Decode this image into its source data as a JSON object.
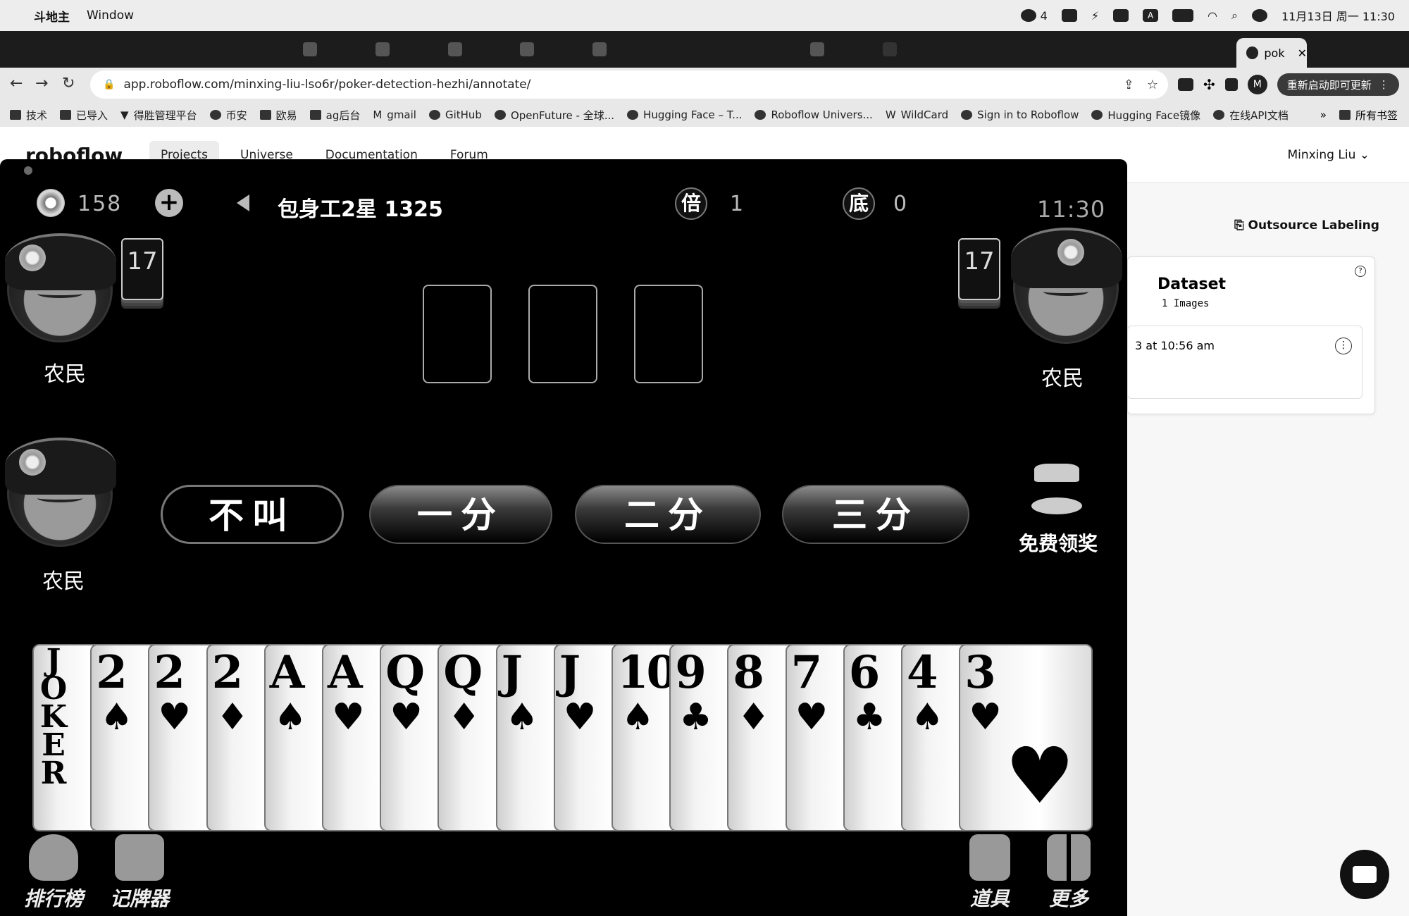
{
  "menubar": {
    "app_name": "斗地主",
    "menu_window": "Window",
    "wechat_count": "4",
    "datetime": "11月13日 周一 11:30"
  },
  "browser": {
    "active_tab_title": "pok",
    "url": "app.roboflow.com/minxing-liu-lso6r/poker-detection-hezhi/annotate/",
    "relaunch_label": "重新启动即可更新",
    "profile_initial": "M",
    "bookmarks": [
      "技术",
      "已导入",
      "得胜管理平台",
      "币安",
      "欧易",
      "ag后台",
      "gmail",
      "GitHub",
      "OpenFuture - 全球...",
      "Hugging Face – T...",
      "Roboflow Univers...",
      "WildCard",
      "Sign in to Roboflow",
      "Hugging Face镜像",
      "在线API文档"
    ],
    "bookmarks_more": "»",
    "all_bookmarks": "所有书签"
  },
  "roboflow": {
    "logo": "roboflow",
    "nav": [
      "Projects",
      "Universe",
      "Documentation",
      "Forum"
    ],
    "user": "Minxing Liu",
    "outsource_label": "Outsource Labeling",
    "dataset_title": "Dataset",
    "dataset_sub": "1 Images",
    "version_time": "3 at 10:56 am"
  },
  "game": {
    "coins": "158",
    "room_title": "包身工2星 1325",
    "multiplier_label": "倍",
    "multiplier_value": "1",
    "base_label": "底",
    "base_value": "0",
    "clock": "11:30",
    "left_player": {
      "cards": "17",
      "role": "农民"
    },
    "right_player": {
      "cards": "17",
      "role": "农民"
    },
    "self_player": {
      "role": "农民"
    },
    "bids": [
      "不叫",
      "一分",
      "二分",
      "三分"
    ],
    "bid_highlight": [
      false,
      true,
      true,
      true
    ],
    "reward_label": "免费领奖",
    "hand": [
      {
        "rank": "JOKER",
        "suit": ""
      },
      {
        "rank": "2",
        "suit": "♠"
      },
      {
        "rank": "2",
        "suit": "♥"
      },
      {
        "rank": "2",
        "suit": "♦"
      },
      {
        "rank": "A",
        "suit": "♠"
      },
      {
        "rank": "A",
        "suit": "♥"
      },
      {
        "rank": "Q",
        "suit": "♥"
      },
      {
        "rank": "Q",
        "suit": "♦"
      },
      {
        "rank": "J",
        "suit": "♠"
      },
      {
        "rank": "J",
        "suit": "♥"
      },
      {
        "rank": "10",
        "suit": "♠"
      },
      {
        "rank": "9",
        "suit": "♣"
      },
      {
        "rank": "8",
        "suit": "♦"
      },
      {
        "rank": "7",
        "suit": "♥"
      },
      {
        "rank": "6",
        "suit": "♣"
      },
      {
        "rank": "4",
        "suit": "♠"
      },
      {
        "rank": "3",
        "suit": "♥"
      }
    ],
    "bottom_left": [
      "排行榜",
      "记牌器"
    ],
    "bottom_right": [
      "道具",
      "更多"
    ]
  },
  "colors": {
    "game_bg": "#000000",
    "page_bg": "#f7f7f7"
  }
}
